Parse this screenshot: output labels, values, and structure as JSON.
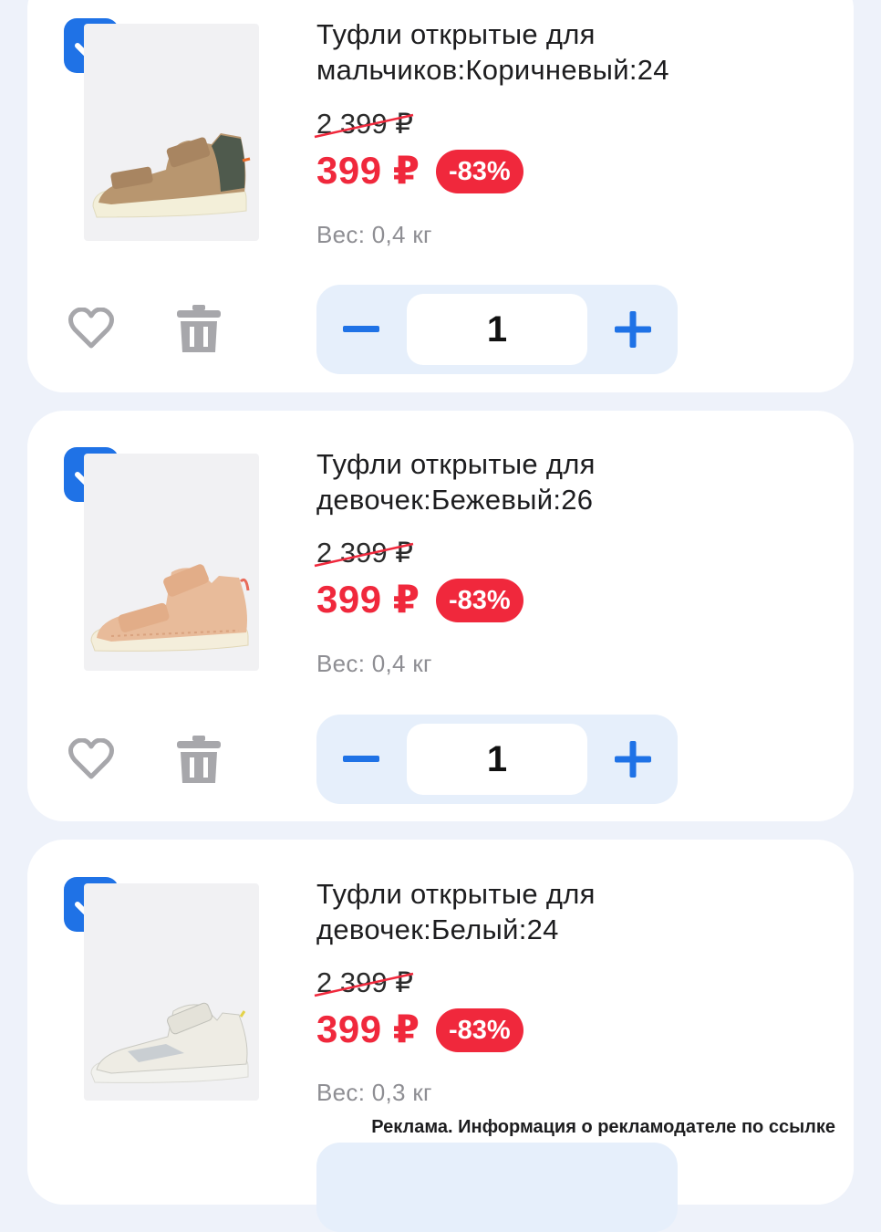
{
  "items": [
    {
      "title_line1": "Туфли открытые для",
      "title_line2": "мальчиков:Коричневый:24",
      "old_price": "2 399 ₽",
      "price": "399 ₽",
      "discount": "-83%",
      "weight": "Вес: 0,4 кг",
      "quantity": "1",
      "checked": true
    },
    {
      "title_line1": "Туфли открытые для",
      "title_line2": "девочек:Бежевый:26",
      "old_price": "2 399 ₽",
      "price": "399 ₽",
      "discount": "-83%",
      "weight": "Вес: 0,4 кг",
      "quantity": "1",
      "checked": true
    },
    {
      "title_line1": "Туфли открытые для",
      "title_line2": "девочек:Белый:24",
      "old_price": "2 399 ₽",
      "price": "399 ₽",
      "discount": "-83%",
      "weight": "Вес: 0,3 кг",
      "checked": true
    }
  ],
  "ad_note": "Реклама. Информация о рекламодателе по ссылке",
  "colors": {
    "accent": "#1f72e6",
    "price_red": "#f0283c",
    "stepper_bg": "#e6effb",
    "page_bg": "#eef2fa"
  },
  "icons": [
    "check-icon",
    "heart-icon",
    "trash-icon",
    "minus-icon",
    "plus-icon"
  ]
}
